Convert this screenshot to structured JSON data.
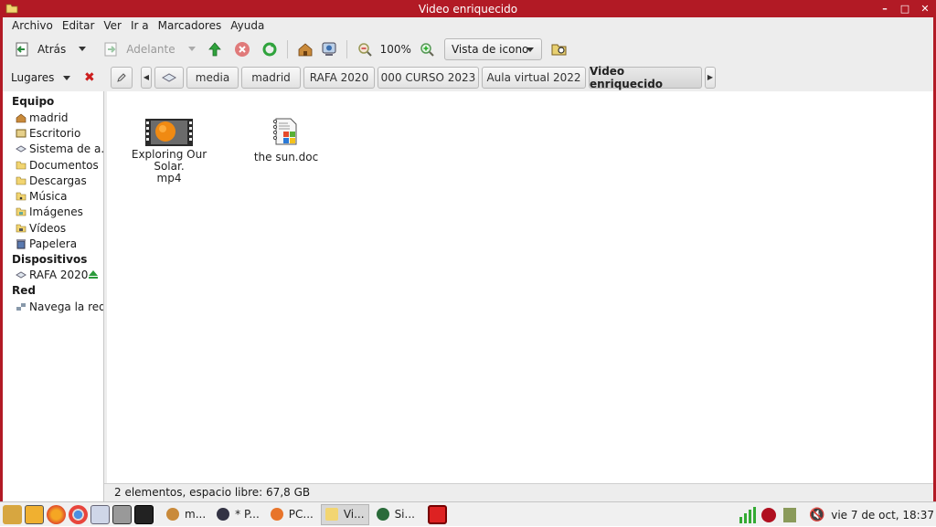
{
  "window": {
    "title": "Video enriquecido"
  },
  "menu": [
    "Archivo",
    "Editar",
    "Ver",
    "Ir a",
    "Marcadores",
    "Ayuda"
  ],
  "toolbar": {
    "back_label": "Atrás",
    "forward_label": "Adelante",
    "zoom_level": "100%",
    "view_mode": "Vista de icono"
  },
  "location": {
    "places_label": "Lugares",
    "crumbs": [
      "media",
      "madrid",
      "RAFA 2020",
      "000 CURSO 2023",
      "Aula virtual 2022",
      "Video enriquecido"
    ]
  },
  "sidebar": {
    "sections": [
      {
        "title": "Equipo",
        "items": [
          {
            "label": "madrid",
            "icon": "home-icon"
          },
          {
            "label": "Escritorio",
            "icon": "desktop-icon"
          },
          {
            "label": "Sistema de a...",
            "icon": "drive-icon"
          },
          {
            "label": "Documentos",
            "icon": "folder-icon"
          },
          {
            "label": "Descargas",
            "icon": "folder-icon"
          },
          {
            "label": "Música",
            "icon": "music-folder-icon"
          },
          {
            "label": "Imágenes",
            "icon": "pictures-folder-icon"
          },
          {
            "label": "Vídeos",
            "icon": "videos-folder-icon"
          },
          {
            "label": "Papelera",
            "icon": "trash-icon"
          }
        ]
      },
      {
        "title": "Dispositivos",
        "items": [
          {
            "label": "RAFA 2020",
            "icon": "drive-icon"
          }
        ]
      },
      {
        "title": "Red",
        "items": [
          {
            "label": "Navega la red",
            "icon": "network-icon"
          }
        ]
      }
    ]
  },
  "files": [
    {
      "name_line1": "Exploring Our Solar.",
      "name_line2": "mp4",
      "icon": "video-thumbnail-icon"
    },
    {
      "name_line1": "the sun.doc",
      "name_line2": "",
      "icon": "document-icon"
    }
  ],
  "status": "2 elementos, espacio libre: 67,8 GB",
  "taskbar": {
    "tasks": [
      "m...",
      "* P...",
      "PC...",
      "Vi...",
      "Si..."
    ],
    "clock": "vie  7 de oct, 18:37"
  },
  "colors": {
    "accent": "#b21a25",
    "chrome": "#ededed"
  }
}
